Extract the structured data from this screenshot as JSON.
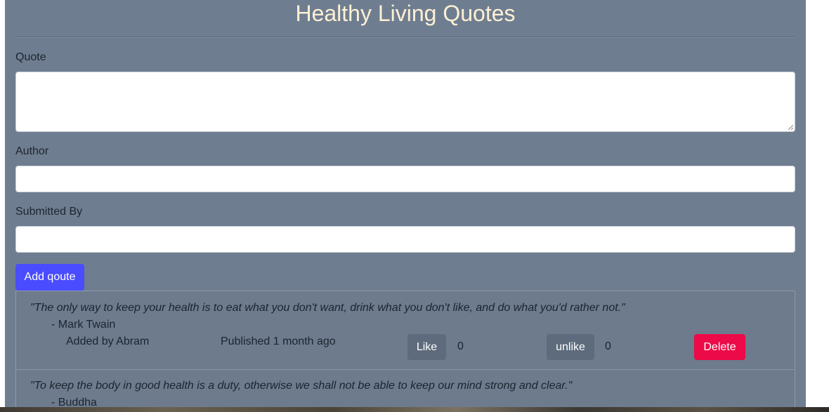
{
  "page": {
    "title": "Healthy Living Quotes"
  },
  "form": {
    "quote_label": "Quote",
    "quote_value": "",
    "author_label": "Author",
    "author_value": "",
    "submitted_label": "Submitted By",
    "submitted_value": "",
    "add_button": "Add qoute"
  },
  "quotes": [
    {
      "text": "\"The only way to keep your health is to eat what you don't want, drink what you don't like, and do what you'd rather not.\"",
      "author": "- Mark Twain",
      "added_by": "Added by Abram",
      "published": "Published 1 month ago",
      "like_label": "Like",
      "like_count": "0",
      "unlike_label": "unlike",
      "unlike_count": "0",
      "delete_label": "Delete"
    },
    {
      "text": "\"To keep the body in good health is a duty, otherwise we shall not be able to keep our mind strong and clear.\"",
      "author": "- Buddha"
    }
  ],
  "colors": {
    "panel": "#6f7d90",
    "title": "#fdf0d4",
    "primary": "#4a4cff",
    "danger": "#ec0a48",
    "secondary": "#5d6b7c"
  }
}
